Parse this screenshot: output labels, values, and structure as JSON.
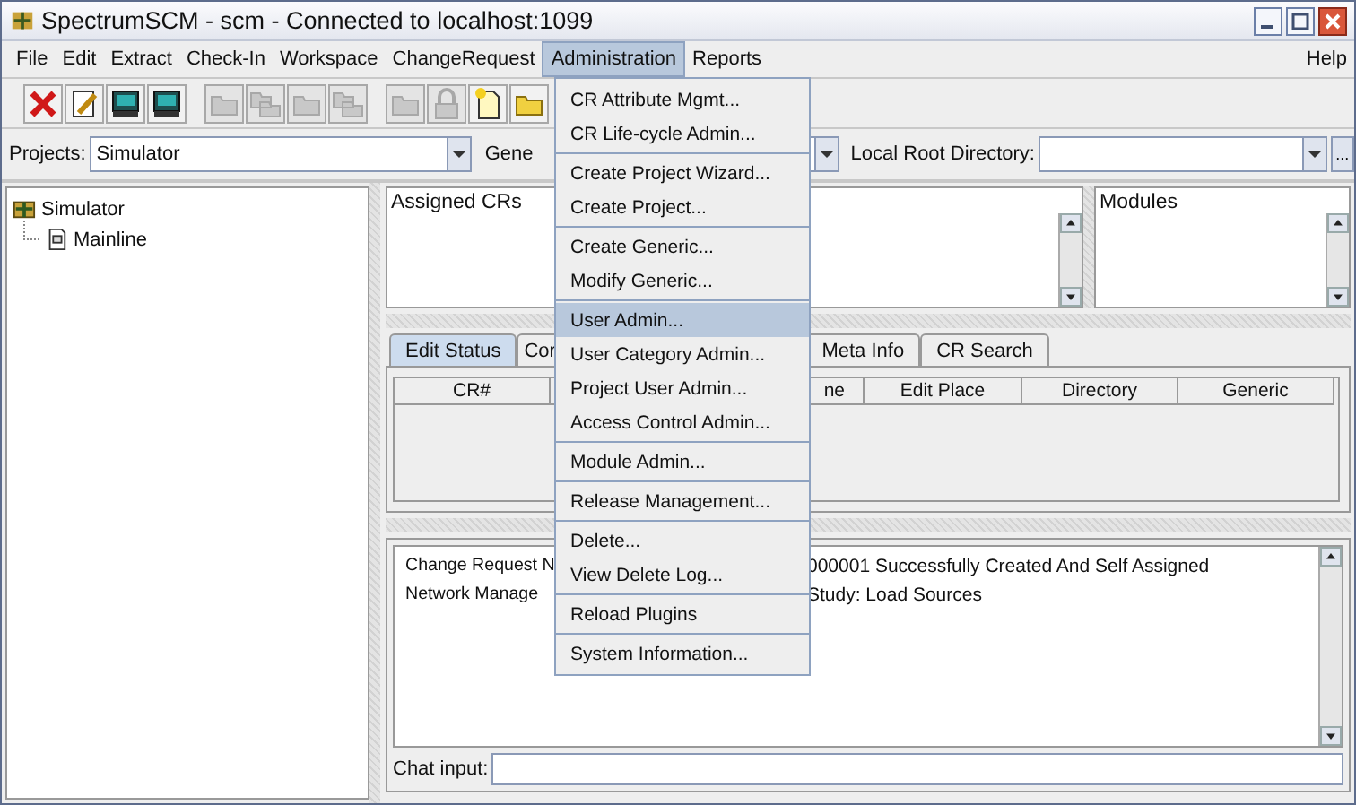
{
  "window": {
    "title": "SpectrumSCM - scm - Connected to localhost:1099"
  },
  "menu_bar": [
    {
      "label": "File",
      "selected": false
    },
    {
      "label": "Edit",
      "selected": false
    },
    {
      "label": "Extract",
      "selected": false
    },
    {
      "label": "Check-In",
      "selected": false
    },
    {
      "label": "Workspace",
      "selected": false
    },
    {
      "label": "ChangeRequest",
      "selected": false
    },
    {
      "label": "Administration",
      "selected": true
    },
    {
      "label": "Reports",
      "selected": false
    }
  ],
  "help_menu": {
    "label": "Help",
    "selected": false
  },
  "toolbar": [
    {
      "kind": "delete",
      "disabled": false
    },
    {
      "kind": "edit",
      "disabled": false
    },
    {
      "kind": "monitor",
      "disabled": false
    },
    {
      "kind": "monitor",
      "disabled": false
    },
    {
      "kind": "folder",
      "disabled": true
    },
    {
      "kind": "folders",
      "disabled": true
    },
    {
      "kind": "folder",
      "disabled": true
    },
    {
      "kind": "folders",
      "disabled": true
    },
    {
      "kind": "folder",
      "disabled": true
    },
    {
      "kind": "lock",
      "disabled": true
    },
    {
      "kind": "new-document",
      "disabled": false
    },
    {
      "kind": "folder",
      "disabled": false
    }
  ],
  "projects_row": {
    "projects_label": "Projects:",
    "project_value": "Simulator",
    "generic_label": "Gene",
    "local_root_label": "Local Root Directory:",
    "browse_button": "..."
  },
  "tree": [
    {
      "label": "Simulator",
      "children": [
        {
          "label": "Mainline"
        }
      ]
    }
  ],
  "assigned_crs": {
    "title": "Assigned CRs"
  },
  "modules": {
    "title": "Modules"
  },
  "tabs": [
    {
      "label": "Edit Status",
      "selected": true
    },
    {
      "label": "Cor",
      "selected": false
    },
    {
      "label": "Meta Info",
      "selected": false
    },
    {
      "label": "CR Search",
      "selected": false
    }
  ],
  "table": {
    "columns": [
      "CR#",
      "ne",
      "Edit Place",
      "Directory",
      "Generic"
    ]
  },
  "log": [
    {
      "left": "Change Request N",
      "right": "000001 Successfully Created And Self Assigned"
    },
    {
      "left": "Network Manage",
      "right": "Study: Load Sources"
    }
  ],
  "chat": {
    "label": "Chat input:"
  },
  "admin_menu": [
    [
      {
        "label": "CR Attribute Mgmt...",
        "selected": false
      },
      {
        "label": "CR Life-cycle Admin...",
        "selected": false
      }
    ],
    [
      {
        "label": "Create Project Wizard...",
        "selected": false
      },
      {
        "label": "Create Project...",
        "selected": false
      }
    ],
    [
      {
        "label": "Create Generic...",
        "selected": false
      },
      {
        "label": "Modify Generic...",
        "selected": false
      }
    ],
    [
      {
        "label": "User Admin...",
        "selected": true
      },
      {
        "label": "User Category Admin...",
        "selected": false
      },
      {
        "label": "Project User Admin...",
        "selected": false
      },
      {
        "label": "Access Control Admin...",
        "selected": false
      }
    ],
    [
      {
        "label": "Module Admin...",
        "selected": false
      }
    ],
    [
      {
        "label": "Release Management...",
        "selected": false
      }
    ],
    [
      {
        "label": "Delete...",
        "selected": false
      },
      {
        "label": "View Delete Log...",
        "selected": false
      }
    ],
    [
      {
        "label": "Reload Plugins",
        "selected": false
      }
    ],
    [
      {
        "label": "System Information...",
        "selected": false
      }
    ]
  ]
}
